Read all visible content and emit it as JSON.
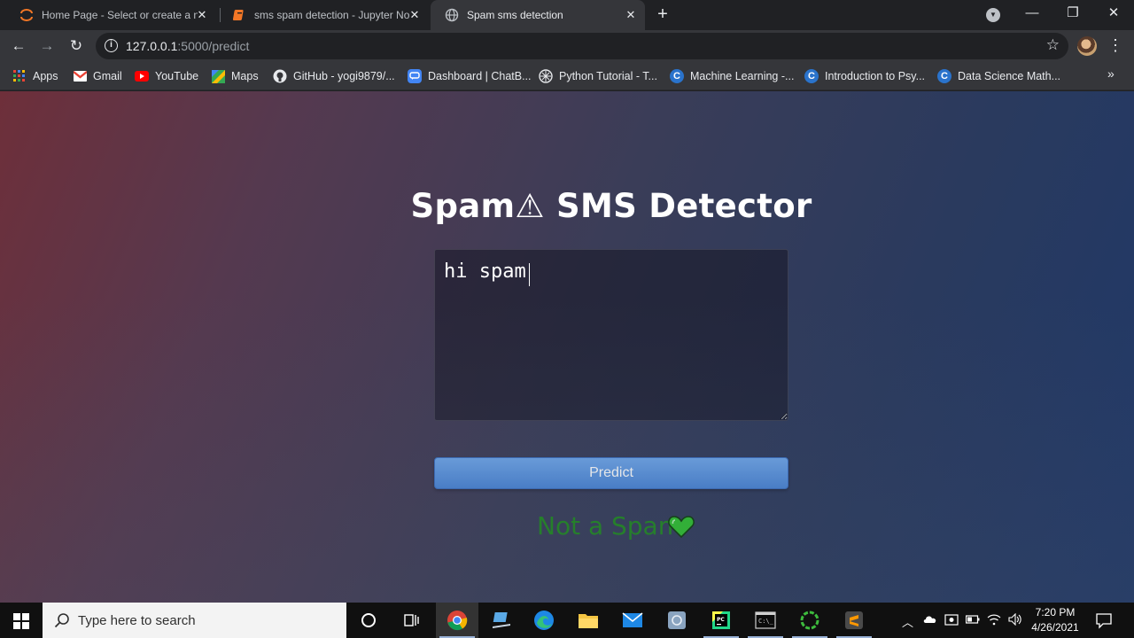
{
  "browser": {
    "tabs": [
      {
        "title": "Home Page - Select or create a n",
        "icon": "jupyter-icon",
        "active": false
      },
      {
        "title": "sms spam detection - Jupyter No",
        "icon": "notebook-icon",
        "active": false
      },
      {
        "title": "Spam sms detection",
        "icon": "globe-icon",
        "active": true
      }
    ],
    "url_host": "127.0.0.1",
    "url_path": ":5000/predict",
    "bookmarks": [
      {
        "label": "Apps",
        "icon": "apps-grid-icon"
      },
      {
        "label": "Gmail",
        "icon": "gmail-icon"
      },
      {
        "label": "YouTube",
        "icon": "youtube-icon"
      },
      {
        "label": "Maps",
        "icon": "maps-icon"
      },
      {
        "label": "GitHub - yogi9879/...",
        "icon": "github-icon"
      },
      {
        "label": "Dashboard | ChatB...",
        "icon": "chat-icon"
      },
      {
        "label": "Python Tutorial - T...",
        "icon": "python-tutorial-icon"
      },
      {
        "label": "Machine Learning -...",
        "icon": "coursera-icon"
      },
      {
        "label": "Introduction to Psy...",
        "icon": "coursera-icon"
      },
      {
        "label": "Data Science Math...",
        "icon": "coursera-icon"
      }
    ]
  },
  "app": {
    "title_left": "Spam",
    "title_warn": "⚠",
    "title_right": " SMS Detector",
    "message_value": "hi spam",
    "predict_label": "Predict",
    "result_text": "Not a Spam",
    "result_color": "#1e8a1e",
    "heart_color": "#2ec52e"
  },
  "taskbar": {
    "search_placeholder": "Type here to search",
    "time": "7:20 PM",
    "date": "4/26/2021"
  }
}
